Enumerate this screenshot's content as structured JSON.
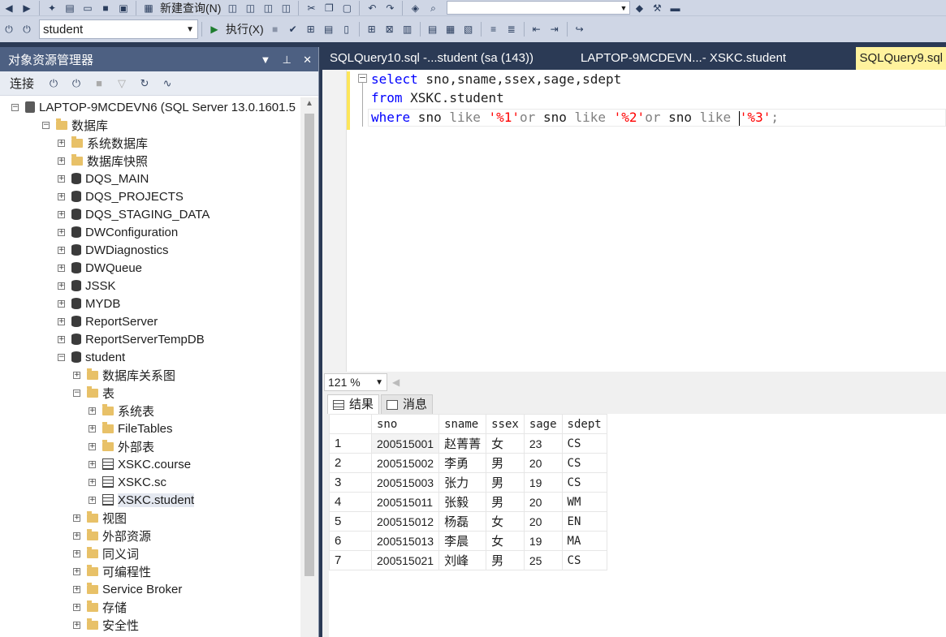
{
  "toolbar": {
    "new_query_label": "新建查询(N)",
    "db_selected": "student",
    "execute_label": "执行(X)"
  },
  "explorer": {
    "title": "对象资源管理器",
    "connect_label": "连接",
    "server": "LAPTOP-9MCDEVN6 (SQL Server 13.0.1601.5",
    "nodes": [
      {
        "label": "数据库",
        "depth": 1,
        "icon": "folder-icon",
        "expanded": true
      },
      {
        "label": "系统数据库",
        "depth": 2,
        "icon": "folder-icon"
      },
      {
        "label": "数据库快照",
        "depth": 2,
        "icon": "folder-icon"
      },
      {
        "label": "DQS_MAIN",
        "depth": 2,
        "icon": "database-icon"
      },
      {
        "label": "DQS_PROJECTS",
        "depth": 2,
        "icon": "database-icon"
      },
      {
        "label": "DQS_STAGING_DATA",
        "depth": 2,
        "icon": "database-icon"
      },
      {
        "label": "DWConfiguration",
        "depth": 2,
        "icon": "database-icon"
      },
      {
        "label": "DWDiagnostics",
        "depth": 2,
        "icon": "database-icon"
      },
      {
        "label": "DWQueue",
        "depth": 2,
        "icon": "database-icon"
      },
      {
        "label": "JSSK",
        "depth": 2,
        "icon": "database-icon"
      },
      {
        "label": "MYDB",
        "depth": 2,
        "icon": "database-icon"
      },
      {
        "label": "ReportServer",
        "depth": 2,
        "icon": "database-icon"
      },
      {
        "label": "ReportServerTempDB",
        "depth": 2,
        "icon": "database-icon"
      },
      {
        "label": "student",
        "depth": 2,
        "icon": "database-icon",
        "expanded": true
      },
      {
        "label": "数据库关系图",
        "depth": 3,
        "icon": "folder-icon"
      },
      {
        "label": "表",
        "depth": 3,
        "icon": "folder-icon",
        "expanded": true
      },
      {
        "label": "系统表",
        "depth": 4,
        "icon": "folder-icon"
      },
      {
        "label": "FileTables",
        "depth": 4,
        "icon": "folder-icon"
      },
      {
        "label": "外部表",
        "depth": 4,
        "icon": "folder-icon"
      },
      {
        "label": "XSKC.course",
        "depth": 4,
        "icon": "table-icon"
      },
      {
        "label": "XSKC.sc",
        "depth": 4,
        "icon": "table-icon"
      },
      {
        "label": "XSKC.student",
        "depth": 4,
        "icon": "table-icon",
        "selected": true
      },
      {
        "label": "视图",
        "depth": 3,
        "icon": "folder-icon"
      },
      {
        "label": "外部资源",
        "depth": 3,
        "icon": "folder-icon"
      },
      {
        "label": "同义词",
        "depth": 3,
        "icon": "folder-icon"
      },
      {
        "label": "可编程性",
        "depth": 3,
        "icon": "folder-icon"
      },
      {
        "label": "Service Broker",
        "depth": 3,
        "icon": "folder-icon"
      },
      {
        "label": "存储",
        "depth": 3,
        "icon": "folder-icon"
      },
      {
        "label": "安全性",
        "depth": 3,
        "icon": "folder-icon"
      }
    ]
  },
  "tabs": [
    {
      "label": "SQLQuery10.sql -...student (sa (143))"
    },
    {
      "label": "LAPTOP-9MCDEVN...- XSKC.student"
    },
    {
      "label": "SQLQuery9.sql"
    }
  ],
  "editor": {
    "line1": {
      "kw": "select",
      "rest": " sno,sname,ssex,sage,sdept"
    },
    "line2": {
      "kw": "from",
      "rest": " XSKC.student"
    },
    "line3": {
      "kw": "where",
      "p1": " sno ",
      "like1": "like",
      "s1": " '%1'",
      "or1": "or",
      "p2": " sno ",
      "like2": "like",
      "s2": " '%2'",
      "or2": "or",
      "p3": " sno ",
      "like3": "like",
      "sp": " ",
      "s3": "'%3'",
      "semi": ";"
    }
  },
  "zoom": "121 %",
  "results": {
    "tab_results": "结果",
    "tab_messages": "消息",
    "columns": [
      "sno",
      "sname",
      "ssex",
      "sage",
      "sdept"
    ],
    "rows": [
      [
        "1",
        "200515001",
        "赵菁菁",
        "女",
        "23",
        "CS"
      ],
      [
        "2",
        "200515002",
        "李勇",
        "男",
        "20",
        "CS"
      ],
      [
        "3",
        "200515003",
        "张力",
        "男",
        "19",
        "CS"
      ],
      [
        "4",
        "200515011",
        "张毅",
        "男",
        "20",
        "WM"
      ],
      [
        "5",
        "200515012",
        "杨磊",
        "女",
        "20",
        "EN"
      ],
      [
        "6",
        "200515013",
        "李晨",
        "女",
        "19",
        "MA"
      ],
      [
        "7",
        "200515021",
        "刘峰",
        "男",
        "25",
        "CS"
      ]
    ]
  }
}
